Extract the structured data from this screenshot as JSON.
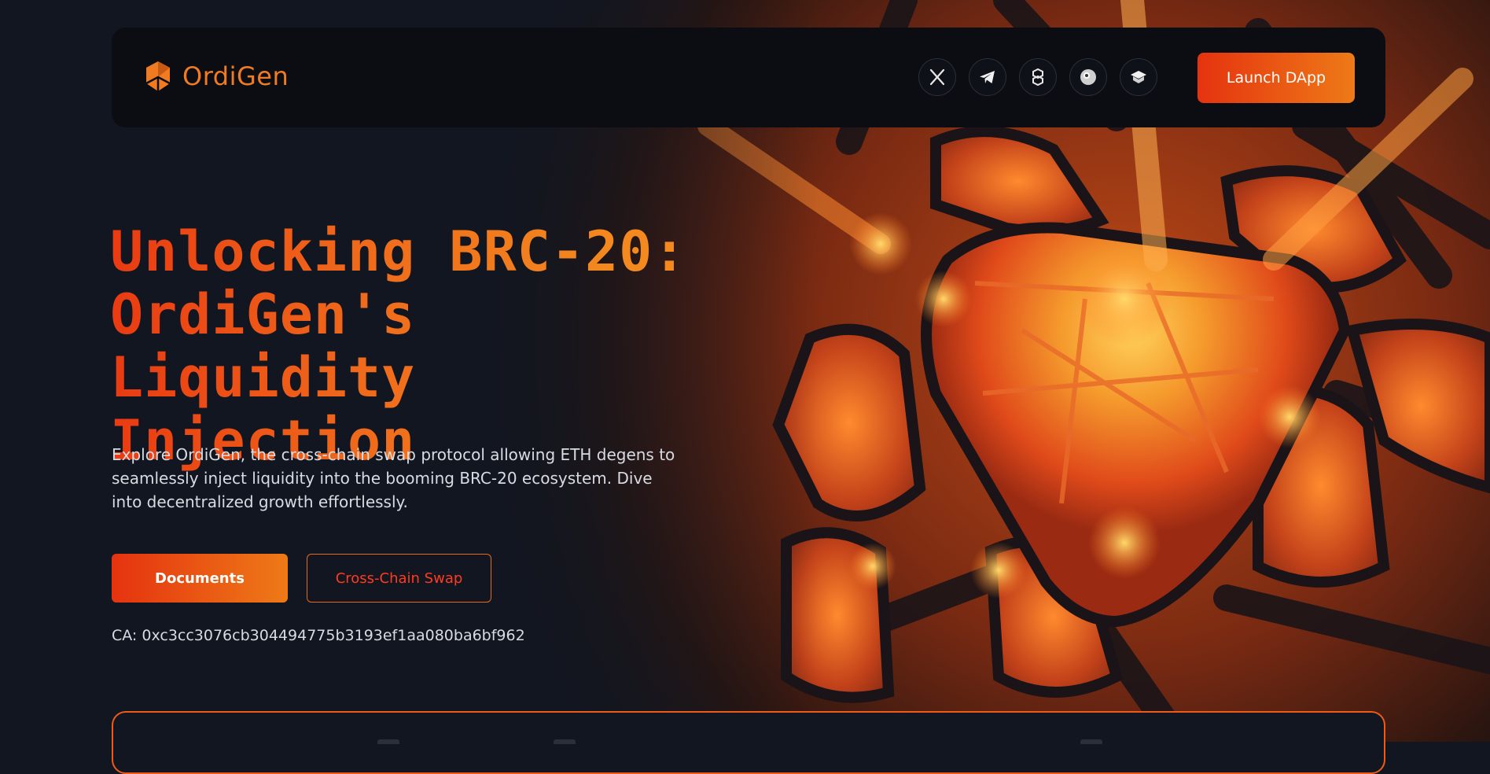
{
  "brand": {
    "name": "OrdiGen",
    "accent": "#f07b21",
    "gradient_start": "#e5330f",
    "gradient_end": "#ee7a17",
    "background": "#121620"
  },
  "header": {
    "socials": [
      {
        "name": "x-twitter",
        "icon": "x-icon"
      },
      {
        "name": "telegram",
        "icon": "telegram-icon"
      },
      {
        "name": "dextools",
        "icon": "dextools-icon"
      },
      {
        "name": "coingecko",
        "icon": "coingecko-icon"
      },
      {
        "name": "docs",
        "icon": "book-icon"
      }
    ],
    "launch_label": "Launch DApp"
  },
  "hero": {
    "title_lines": [
      "Unlocking BRC-20:",
      "OrdiGen's Liquidity",
      "Injection"
    ],
    "description": "Explore OrdiGen, the cross-chain swap protocol allowing ETH degens to seamlessly inject liquidity into the booming BRC-20 ecosystem. Dive into decentralized growth effortlessly.",
    "primary_button": "Documents",
    "secondary_button": "Cross-Chain Swap",
    "contract": "CA: 0xc3cc3076cb304494775b3193ef1aa080ba6bf962"
  }
}
